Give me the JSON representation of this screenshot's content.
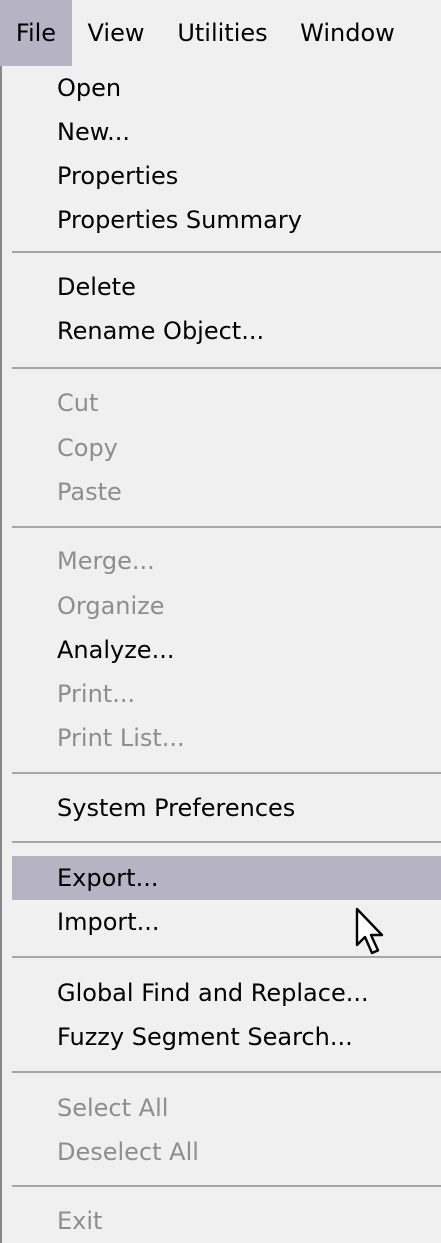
{
  "menubar": {
    "items": [
      {
        "label": "File"
      },
      {
        "label": "View"
      },
      {
        "label": "Utilities"
      },
      {
        "label": "Window"
      }
    ]
  },
  "menu": {
    "items": [
      {
        "label": "Open",
        "enabled": true
      },
      {
        "label": "New...",
        "enabled": true
      },
      {
        "label": "Properties",
        "enabled": true
      },
      {
        "label": "Properties Summary",
        "enabled": true
      },
      {
        "label": "Delete",
        "enabled": true
      },
      {
        "label": "Rename Object...",
        "enabled": true
      },
      {
        "label": "Cut",
        "enabled": false
      },
      {
        "label": "Copy",
        "enabled": false
      },
      {
        "label": "Paste",
        "enabled": false
      },
      {
        "label": "Merge...",
        "enabled": false
      },
      {
        "label": "Organize",
        "enabled": false
      },
      {
        "label": "Analyze...",
        "enabled": true
      },
      {
        "label": "Print...",
        "enabled": false
      },
      {
        "label": "Print List...",
        "enabled": false
      },
      {
        "label": "System Preferences",
        "enabled": true
      },
      {
        "label": "Export...",
        "enabled": true,
        "highlighted": true
      },
      {
        "label": "Import...",
        "enabled": true
      },
      {
        "label": "Global Find and Replace...",
        "enabled": true
      },
      {
        "label": "Fuzzy Segment Search...",
        "enabled": true
      },
      {
        "label": "Select All",
        "enabled": false
      },
      {
        "label": "Deselect All",
        "enabled": false
      },
      {
        "label": "Exit",
        "enabled": false
      }
    ]
  },
  "colors": {
    "menu_bg": "#f0f0f0",
    "highlight": "#b5b3c4",
    "disabled_text": "#8e8e8e",
    "separator": "#a6a6a6"
  }
}
